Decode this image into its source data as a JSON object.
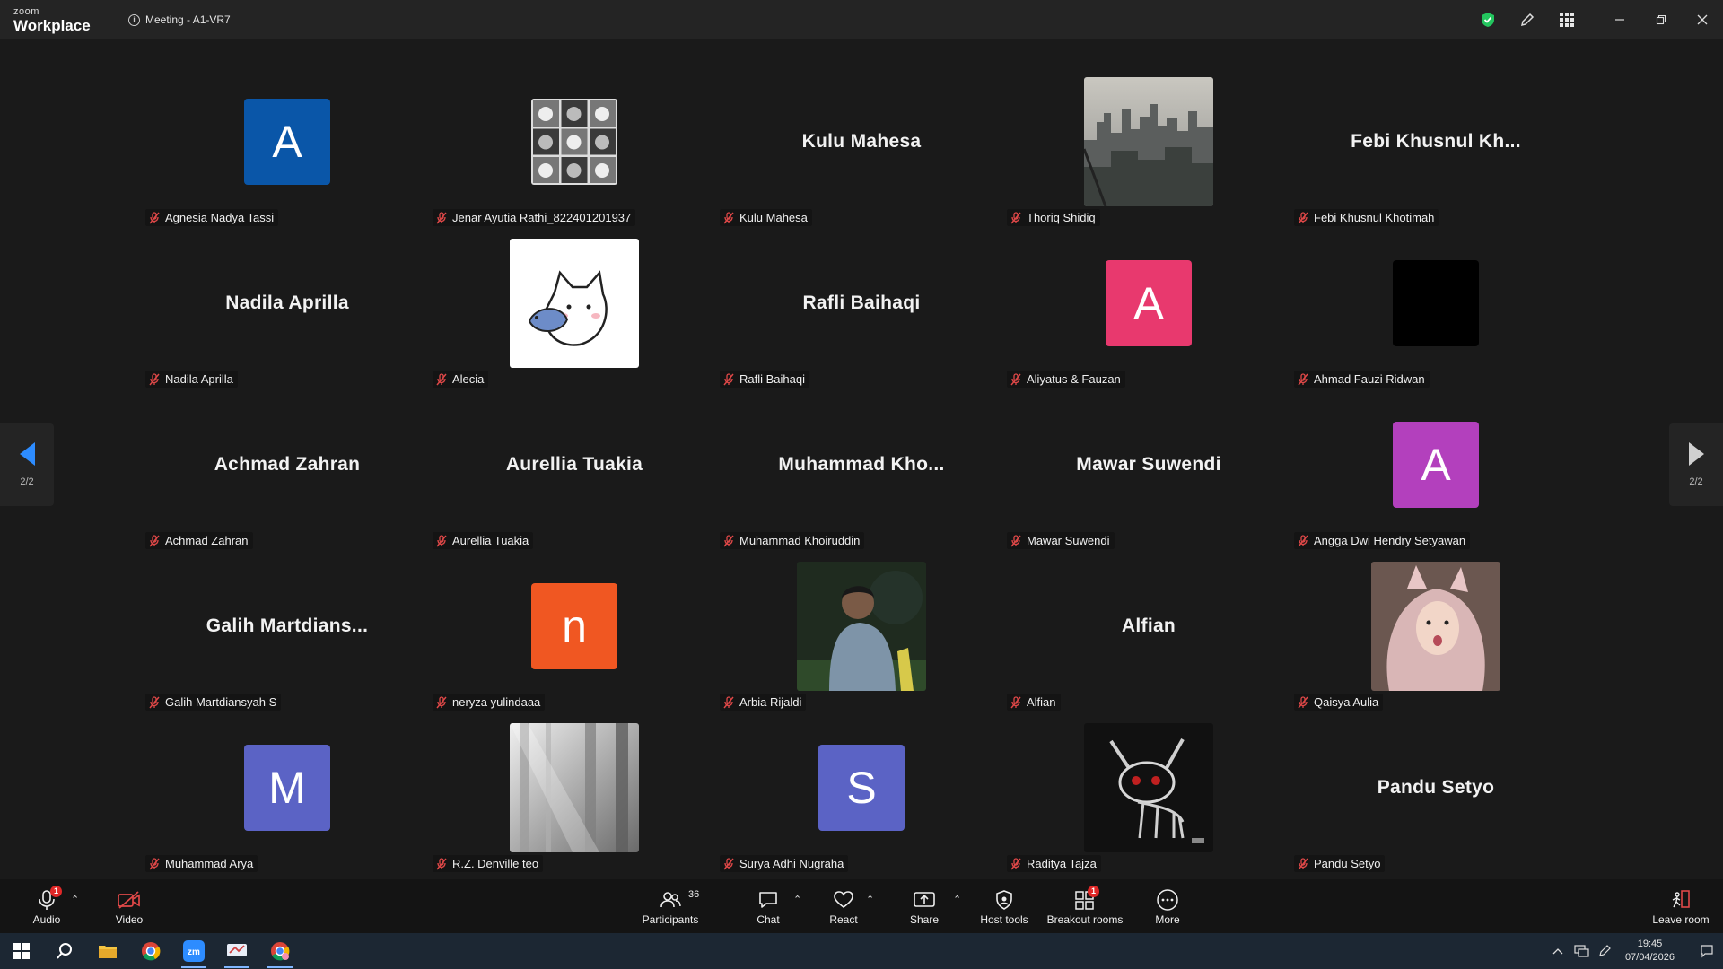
{
  "app": {
    "brand_small": "zoom",
    "brand_big": "Workplace",
    "meeting_title": "Meeting - A1-VR7"
  },
  "pager": {
    "left": "2/2",
    "right": "2/2"
  },
  "participants": [
    {
      "name": "Agnesia Nadya Tassi",
      "display": "avatar",
      "letter": "A",
      "color": "#0a56a8"
    },
    {
      "name": "Jenar Ayutia Rathi_822401201937",
      "display": "photo",
      "photo": "cats-grid-photo"
    },
    {
      "name": "Kulu Mahesa",
      "display": "name",
      "big_name": "Kulu Mahesa"
    },
    {
      "name": "Thoriq Shidiq",
      "display": "photo",
      "photo": "city-skyline-photo"
    },
    {
      "name": "Febi Khusnul Khotimah",
      "display": "name",
      "big_name": "Febi  Khusnul  Kh..."
    },
    {
      "name": "Nadila Aprilla",
      "display": "name",
      "big_name": "Nadila Aprilla"
    },
    {
      "name": "Alecia",
      "display": "photo",
      "photo": "cartoon-cat-photo"
    },
    {
      "name": "Rafli Baihaqi",
      "display": "name",
      "big_name": "Rafli Baihaqi"
    },
    {
      "name": "Aliyatus & Fauzan",
      "display": "avatar",
      "letter": "A",
      "color": "#e8396e"
    },
    {
      "name": "Ahmad Fauzi Ridwan",
      "display": "avatar",
      "letter": "",
      "color": "#000000"
    },
    {
      "name": "Achmad Zahran",
      "display": "name",
      "big_name": "Achmad Zahran"
    },
    {
      "name": "Aurellia Tuakia",
      "display": "name",
      "big_name": "Aurellia Tuakia"
    },
    {
      "name": "Muhammad Khoiruddin",
      "display": "name",
      "big_name": "Muhammad  Kho..."
    },
    {
      "name": "Mawar Suwendi",
      "display": "name",
      "big_name": "Mawar Suwendi"
    },
    {
      "name": "Angga Dwi Hendry Setyawan",
      "display": "avatar",
      "letter": "A",
      "color": "#b340bd"
    },
    {
      "name": "Galih Martdiansyah S",
      "display": "name",
      "big_name": "Galih  Martdians..."
    },
    {
      "name": "neryza yulindaaa",
      "display": "avatar",
      "letter": "n",
      "color": "#f05722"
    },
    {
      "name": "Arbia Rijaldi",
      "display": "photo",
      "photo": "football-player-photo"
    },
    {
      "name": "Alfian",
      "display": "name",
      "big_name": "Alfian"
    },
    {
      "name": "Qaisya Aulia",
      "display": "photo",
      "photo": "girl-hood-photo"
    },
    {
      "name": "Muhammad Arya",
      "display": "avatar",
      "letter": "M",
      "color": "#5b63c5"
    },
    {
      "name": "R.Z. Denville teo",
      "display": "photo",
      "photo": "foggy-forest-photo"
    },
    {
      "name": "Surya Adhi Nugraha",
      "display": "avatar",
      "letter": "S",
      "color": "#5b63c5"
    },
    {
      "name": "Raditya Tajza",
      "display": "photo",
      "photo": "drawn-animal-photo"
    },
    {
      "name": "Pandu Setyo",
      "display": "name",
      "big_name": "Pandu Setyo"
    }
  ],
  "toolbar": {
    "audio": "Audio",
    "video": "Video",
    "participants": "Participants",
    "participants_count": "36",
    "chat": "Chat",
    "react": "React",
    "share": "Share",
    "host_tools": "Host tools",
    "breakout_rooms": "Breakout rooms",
    "breakout_badge": "1",
    "more": "More",
    "leave": "Leave room",
    "audio_badge": "1"
  },
  "taskbar": {
    "time": "19:45",
    "date": "07/04/2026"
  },
  "colors": {
    "accent": "#2d8cff",
    "muted_red": "#e04848",
    "shield_green": "#23c55e"
  }
}
